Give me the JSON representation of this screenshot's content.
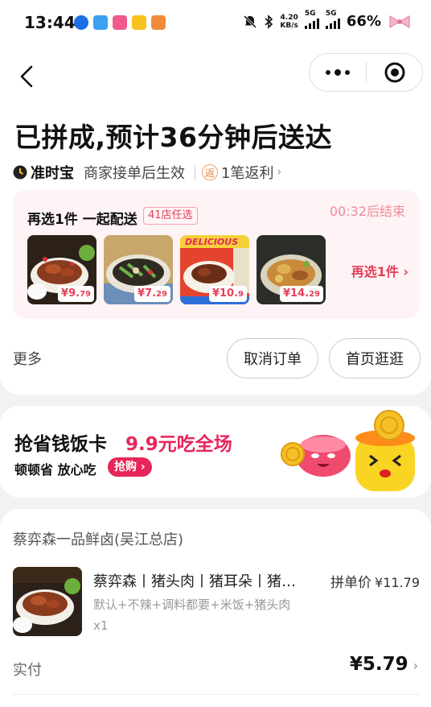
{
  "status_bar": {
    "time": "13:44",
    "net_speed": "4.20",
    "net_speed_unit": "KB/s",
    "sim1": "5G",
    "sim2": "5G",
    "battery": "66%"
  },
  "nav": {
    "back_icon": "chevron-left-icon",
    "more_icon": "more-dots-icon",
    "close_icon": "target-circle-icon"
  },
  "order_status": {
    "title": "已拼成,预计36分钟后送达",
    "guarantee_label": "准时宝",
    "guarantee_desc": "商家接单后生效",
    "rebate_badge": "返",
    "rebate_text": "1笔返利"
  },
  "add_one": {
    "title": "再选1件 一起配送",
    "store_tag": "41店任选",
    "countdown": "00:32后结束",
    "reselect_label": "再选1件 ›",
    "items": [
      {
        "price_main": "¥9.",
        "price_dec": "79"
      },
      {
        "price_main": "¥7.",
        "price_dec": "29"
      },
      {
        "price_main": "¥10.",
        "price_dec": "9"
      },
      {
        "price_main": "¥14.",
        "price_dec": "29"
      }
    ],
    "delicious_banner": "DELICIOUS"
  },
  "actions": {
    "more": "更多",
    "cancel": "取消订单",
    "home": "首页逛逛"
  },
  "promo": {
    "title": "抢省钱饭卡",
    "highlight": "9.9元吃全场",
    "subtitle": "顿顿省 放心吃",
    "buy_label": "抢购 ›"
  },
  "order": {
    "shop_name": "蔡弈森一品鲜卤(吴江总店)",
    "item_name": "蔡弈森丨猪头肉丨猪耳朵丨猪…",
    "price_label": "拼单价",
    "price_value": "¥11.79",
    "spec": "默认+不辣+调料都要+米饭+猪头肉",
    "qty": "x1",
    "paid_label": "实付",
    "paid_value": "¥5.79"
  },
  "colors": {
    "accent": "#e63e57",
    "promo_pink": "#e8255a",
    "add_bg": "#fef3f5"
  }
}
